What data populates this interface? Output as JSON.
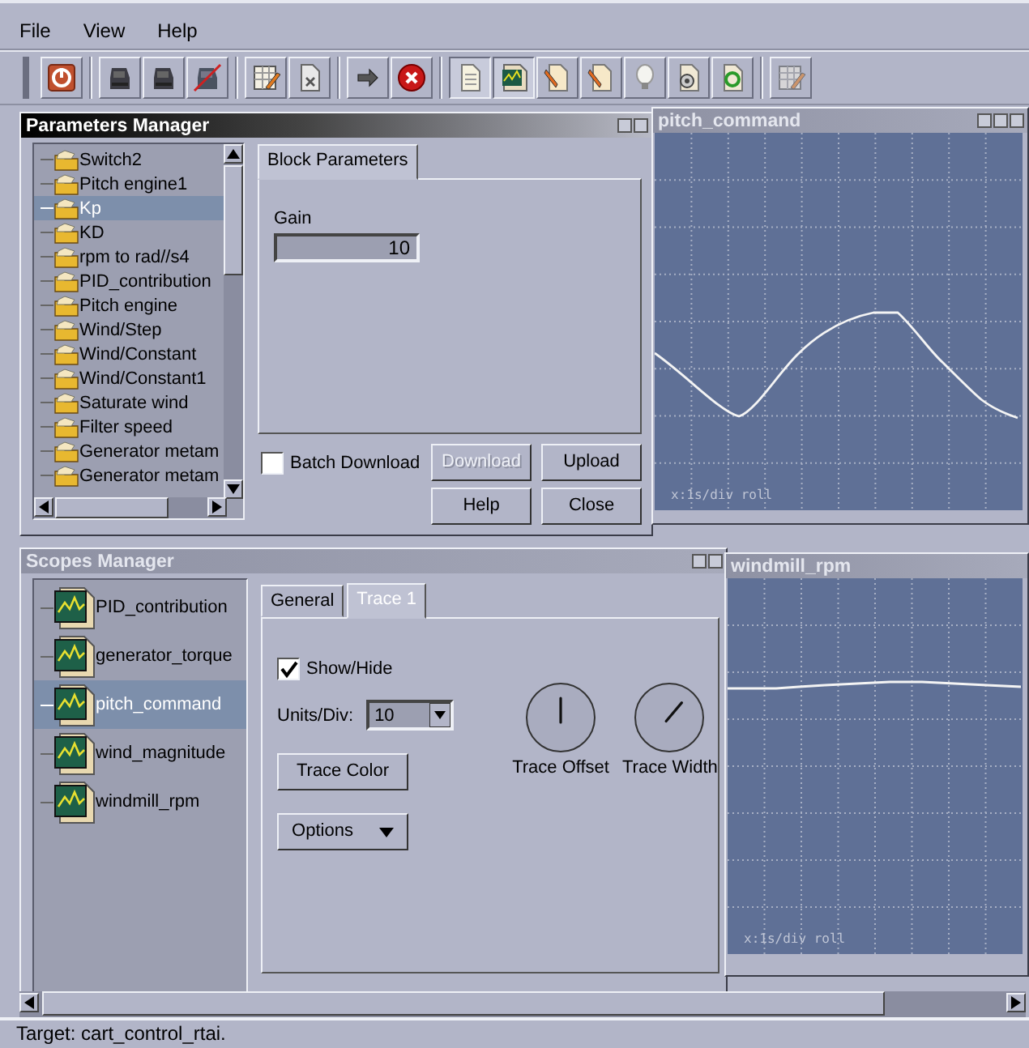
{
  "menu": [
    "File",
    "View",
    "Help"
  ],
  "toolbar": [
    {
      "kind": "power",
      "pressed": false,
      "disabled": false
    },
    {
      "kind": "device",
      "pressed": false,
      "disabled": false
    },
    {
      "kind": "device",
      "pressed": false,
      "disabled": false
    },
    {
      "kind": "device-off",
      "pressed": false,
      "disabled": false
    },
    {
      "kind": "table-edit",
      "pressed": false,
      "disabled": false
    },
    {
      "kind": "doc-close",
      "pressed": false,
      "disabled": false
    },
    {
      "kind": "arrow",
      "pressed": false,
      "disabled": false
    },
    {
      "kind": "stop",
      "pressed": false,
      "disabled": false
    },
    {
      "kind": "doc",
      "pressed": true,
      "disabled": false
    },
    {
      "kind": "chart",
      "pressed": true,
      "disabled": false
    },
    {
      "kind": "doc-edit",
      "pressed": false,
      "disabled": false
    },
    {
      "kind": "doc-edit",
      "pressed": false,
      "disabled": false
    },
    {
      "kind": "bulb",
      "pressed": false,
      "disabled": false
    },
    {
      "kind": "doc-gear",
      "pressed": false,
      "disabled": false
    },
    {
      "kind": "doc-refresh",
      "pressed": false,
      "disabled": false
    },
    {
      "kind": "table-edit",
      "pressed": false,
      "disabled": true
    }
  ],
  "parameters_manager": {
    "title": "Parameters Manager",
    "active": true,
    "tree": [
      {
        "label": "Switch2",
        "selected": false
      },
      {
        "label": "Pitch engine1",
        "selected": false
      },
      {
        "label": "Kp",
        "selected": true
      },
      {
        "label": "KD",
        "selected": false
      },
      {
        "label": "rpm to rad//s4",
        "selected": false
      },
      {
        "label": "PID_contribution",
        "selected": false
      },
      {
        "label": "Pitch engine",
        "selected": false
      },
      {
        "label": "Wind/Step",
        "selected": false
      },
      {
        "label": "Wind/Constant",
        "selected": false
      },
      {
        "label": "Wind/Constant1",
        "selected": false
      },
      {
        "label": "Saturate wind",
        "selected": false
      },
      {
        "label": "Filter speed",
        "selected": false
      },
      {
        "label": "Generator metam",
        "selected": false
      },
      {
        "label": "Generator metam",
        "selected": false
      }
    ],
    "tabs": [
      {
        "label": "Block Parameters",
        "selected": true
      }
    ],
    "field": {
      "label": "Gain",
      "value": "10"
    },
    "batch_download": {
      "label": "Batch Download",
      "checked": false
    },
    "buttons": [
      {
        "label": "Download",
        "disabled": true
      },
      {
        "label": "Upload",
        "disabled": false
      },
      {
        "label": "Help",
        "disabled": false
      },
      {
        "label": "Close",
        "disabled": false
      }
    ]
  },
  "pitch_scope": {
    "title": "pitch_command",
    "active": false,
    "note": "x:1s/div roll"
  },
  "scopes_manager": {
    "title": "Scopes Manager",
    "active": false,
    "tree": [
      {
        "label": "PID_contribution",
        "selected": false
      },
      {
        "label": "generator_torque",
        "selected": false
      },
      {
        "label": "pitch_command",
        "selected": true
      },
      {
        "label": "wind_magnitude",
        "selected": false
      },
      {
        "label": "windmill_rpm",
        "selected": false
      }
    ],
    "tabs": [
      {
        "label": "General",
        "selected": false
      },
      {
        "label": "Trace 1",
        "selected": true
      }
    ],
    "show_hide": {
      "label": "Show/Hide",
      "checked": true
    },
    "units_div": {
      "label": "Units/Div:",
      "value": "10"
    },
    "trace_color_button": "Trace Color",
    "options_button": "Options",
    "knobs": [
      {
        "label": "Trace Offset"
      },
      {
        "label": "Trace Width"
      }
    ]
  },
  "windmill_scope": {
    "title": "windmill_rpm",
    "active": false,
    "note": "x:1s/div roll"
  },
  "status_bar": "Target: cart_control_rtai."
}
